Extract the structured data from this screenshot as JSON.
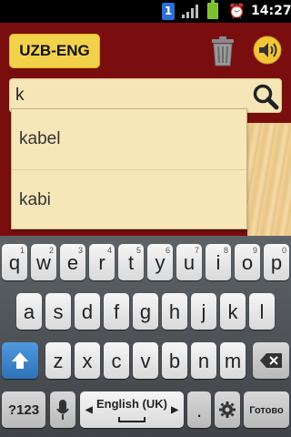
{
  "status": {
    "sim": "1",
    "time": "14:27"
  },
  "app": {
    "lang_button": "UZB-ENG",
    "search": {
      "value": "k",
      "placeholder": ""
    },
    "suggestions": [
      "kabel",
      "kabi"
    ]
  },
  "keyboard": {
    "row1": [
      {
        "k": "q",
        "h": "1"
      },
      {
        "k": "w",
        "h": "2"
      },
      {
        "k": "e",
        "h": "3"
      },
      {
        "k": "r",
        "h": "4"
      },
      {
        "k": "t",
        "h": "5"
      },
      {
        "k": "y",
        "h": "6"
      },
      {
        "k": "u",
        "h": "7"
      },
      {
        "k": "i",
        "h": "8"
      },
      {
        "k": "o",
        "h": "9"
      },
      {
        "k": "p",
        "h": "0"
      }
    ],
    "row2": [
      "a",
      "s",
      "d",
      "f",
      "g",
      "h",
      "j",
      "k",
      "l"
    ],
    "row3": [
      "z",
      "x",
      "c",
      "v",
      "b",
      "n",
      "m"
    ],
    "symbols_key": "?123",
    "language_key": "English (UK)",
    "period_key": ".",
    "done_key": "Готово"
  },
  "icons": {
    "shift": "shift-arrow-icon",
    "delete": "backspace-icon",
    "mic": "microphone-icon",
    "settings": "gear-icon",
    "search": "magnifier-icon",
    "trash": "trash-icon",
    "speaker": "speaker-icon"
  }
}
